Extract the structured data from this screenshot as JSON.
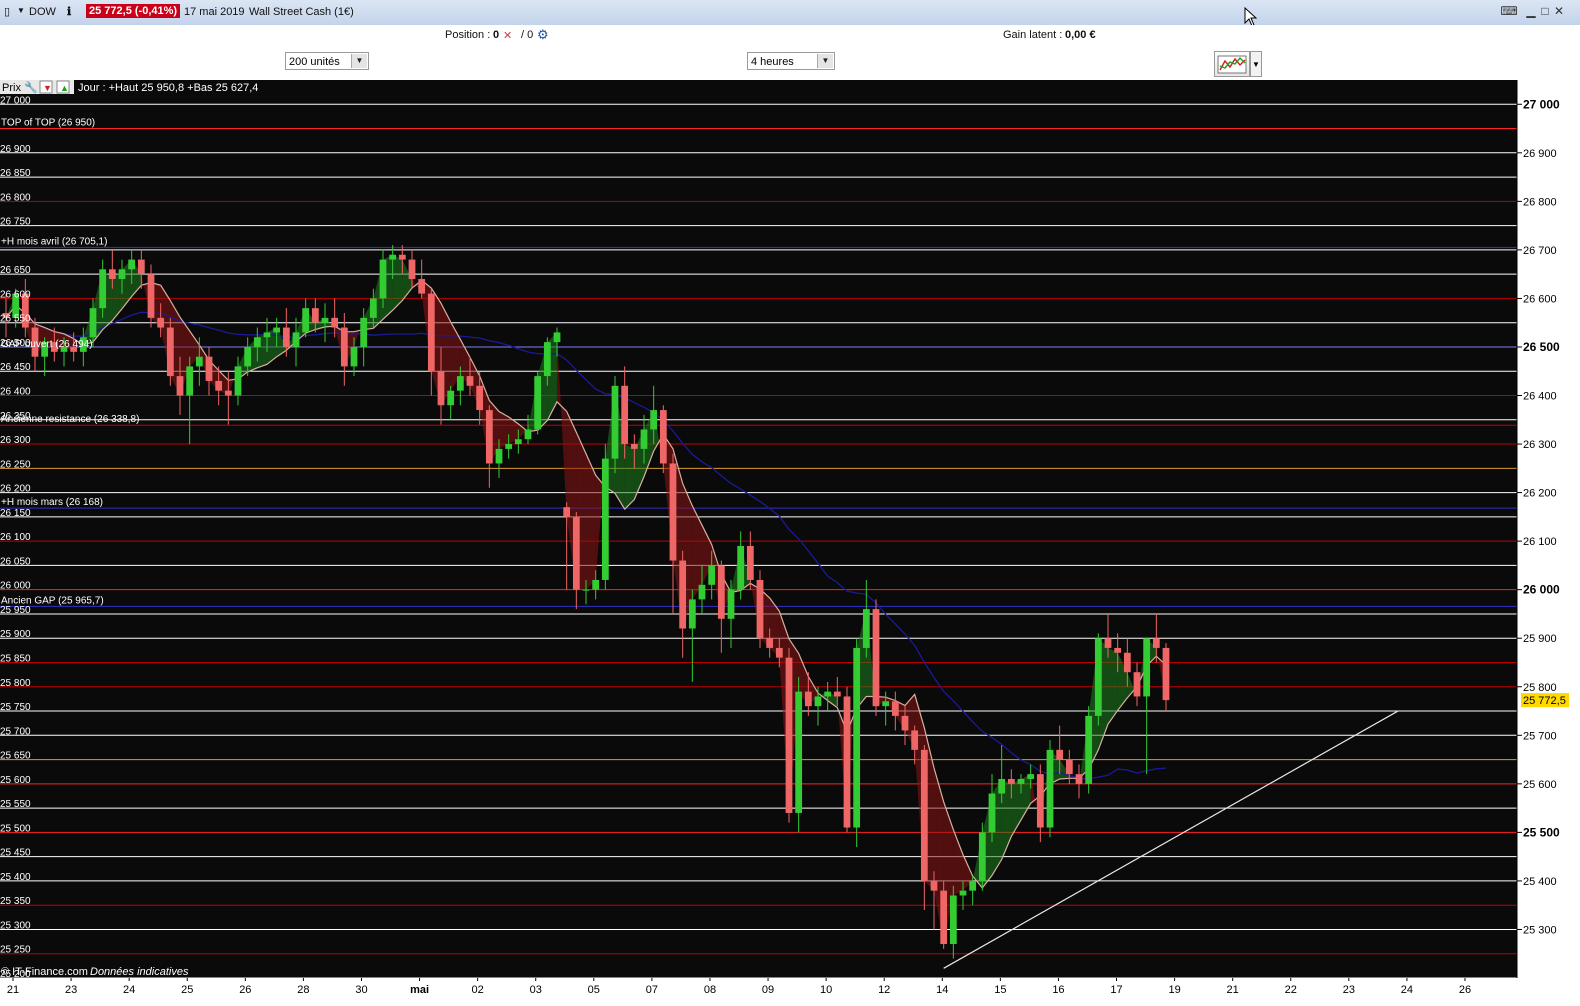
{
  "window": {
    "symbol": "DOW",
    "price_badge": "25 772,5 (-0,41%)",
    "date": "17 mai 2019",
    "instrument": "Wall Street Cash (1€)"
  },
  "infobar": {
    "position_label": "Position :",
    "position_value": "0",
    "position_sep": "/ 0",
    "gain_label": "Gain latent :",
    "gain_value": "0,00 €"
  },
  "toolbar": {
    "units_value": "200 unités",
    "timeframe_value": "4 heures"
  },
  "legend": {
    "prix": "Prix",
    "day_info": "Jour : +Haut 25 950,8 +Bas 25 627,4"
  },
  "footer": {
    "source": "© IT-Finance.com",
    "note": "Données indicatives"
  },
  "icons": [
    "window-icon",
    "dropdown-icon",
    "info-icon",
    "wrench-icon",
    "arrow-down-icon",
    "arrow-up-icon",
    "close-icon",
    "gear-icon",
    "keyboard-icon",
    "minimize-icon",
    "maximize-icon",
    "cursor-icon",
    "chart-type-icon",
    "chevron-down-icon"
  ],
  "colors": {
    "background": "#000000",
    "bull": "#33cc33",
    "bear": "#ee6666",
    "ma_short": "#d8b0a0",
    "ma_long": "#1a1a99",
    "price_tag": "#ffd800"
  },
  "chart_data": {
    "type": "candlestick",
    "ylim": [
      25200,
      27050
    ],
    "price_axis_ticks": [
      27000,
      26900,
      26800,
      26700,
      26600,
      26500,
      26400,
      26300,
      26200,
      26100,
      26000,
      25900,
      25800,
      25700,
      25600,
      25500,
      25400,
      25300
    ],
    "price_axis_bold": [
      27000,
      26500,
      26000,
      25500
    ],
    "left_level_labels": [
      "27 000",
      "26 900",
      "26 850",
      "26 800",
      "26 750",
      "26 650",
      "26 600",
      "26 550",
      "26 500",
      "26 450",
      "26 400",
      "26 350",
      "26 300",
      "26 250",
      "26 200",
      "26 150",
      "26 100",
      "26 050",
      "26 000",
      "25 950",
      "25 900",
      "25 850",
      "25 800",
      "25 750",
      "25 700",
      "25 650",
      "25 600",
      "25 550",
      "25 500",
      "25 450",
      "25 400",
      "25 350",
      "25 300",
      "25 250",
      "25 200"
    ],
    "level_label_values": [
      27000,
      26900,
      26850,
      26800,
      26750,
      26650,
      26600,
      26550,
      26500,
      26450,
      26400,
      26350,
      26300,
      26250,
      26200,
      26150,
      26100,
      26050,
      26000,
      25950,
      25900,
      25850,
      25800,
      25750,
      25700,
      25650,
      25600,
      25550,
      25500,
      25450,
      25400,
      25350,
      25300,
      25250,
      25200
    ],
    "grid_lines": [
      {
        "value": 27000,
        "color": "#ffffff"
      },
      {
        "value": 26950,
        "color": "#ff2020"
      },
      {
        "value": 26900,
        "color": "#ffffff"
      },
      {
        "value": 26850,
        "color": "#ffffff"
      },
      {
        "value": 26800,
        "color": "#c00000"
      },
      {
        "value": 26750,
        "color": "#ffffff"
      },
      {
        "value": 26705.1,
        "color": "#3030cc"
      },
      {
        "value": 26700,
        "color": "#ffffff"
      },
      {
        "value": 26650,
        "color": "#ffffff"
      },
      {
        "value": 26600,
        "color": "#c00000"
      },
      {
        "value": 26550,
        "color": "#ffffff"
      },
      {
        "value": 26500,
        "color": "#8080ff"
      },
      {
        "value": 26450,
        "color": "#ffffff"
      },
      {
        "value": 26400,
        "color": "#c00000"
      },
      {
        "value": 26350,
        "color": "#ffffff"
      },
      {
        "value": 26338.8,
        "color": "#c00000"
      },
      {
        "value": 26300,
        "color": "#c00000"
      },
      {
        "value": 26250,
        "color": "#d89a30"
      },
      {
        "value": 26200,
        "color": "#ffffff"
      },
      {
        "value": 26168,
        "color": "#3030cc"
      },
      {
        "value": 26150,
        "color": "#ffffff"
      },
      {
        "value": 26100,
        "color": "#c00000"
      },
      {
        "value": 26050,
        "color": "#ffffff"
      },
      {
        "value": 26000,
        "color": "#ff2020"
      },
      {
        "value": 25965.7,
        "color": "#3030cc"
      },
      {
        "value": 25950,
        "color": "#ffffff"
      },
      {
        "value": 25900,
        "color": "#ffffff"
      },
      {
        "value": 25850,
        "color": "#c00000"
      },
      {
        "value": 25800,
        "color": "#c00000"
      },
      {
        "value": 25750,
        "color": "#ffffff"
      },
      {
        "value": 25700,
        "color": "#ffffff"
      },
      {
        "value": 25650,
        "color": "#d89a30"
      },
      {
        "value": 25600,
        "color": "#ff2020"
      },
      {
        "value": 25550,
        "color": "#ffffff"
      },
      {
        "value": 25500,
        "color": "#ff2020"
      },
      {
        "value": 25450,
        "color": "#ffffff"
      },
      {
        "value": 25400,
        "color": "#ffffff"
      },
      {
        "value": 25350,
        "color": "#c00000"
      },
      {
        "value": 25300,
        "color": "#ffffff"
      },
      {
        "value": 25250,
        "color": "#c00000"
      },
      {
        "value": 25200,
        "color": "#ffffff"
      }
    ],
    "annotations": [
      {
        "text": "TOP of TOP (26 950)",
        "value": 26950
      },
      {
        "text": "+H mois avril (26 705,1)",
        "value": 26705.1
      },
      {
        "text": "GAP ouvert (26 494)",
        "value": 26494
      },
      {
        "text": "Ancienne resistance (26 338,8)",
        "value": 26338.8
      },
      {
        "text": "+H mois mars (26 168)",
        "value": 26168
      },
      {
        "text": "Ancien GAP (25 965,7)",
        "value": 25965.7
      }
    ],
    "last_price": 25772.5,
    "last_price_label": "25 772,5",
    "x_labels": [
      "21",
      "23",
      "24",
      "25",
      "26",
      "28",
      "30",
      "mai",
      "02",
      "03",
      "05",
      "07",
      "08",
      "09",
      "10",
      "12",
      "14",
      "15",
      "16",
      "17",
      "19",
      "21",
      "22",
      "23",
      "24",
      "26"
    ],
    "trendline": [
      {
        "bar": 0,
        "value": 25220
      },
      {
        "bar": 1,
        "value": 25750
      }
    ],
    "candles": [
      [
        26570,
        26610,
        26520,
        26560
      ],
      [
        26560,
        26620,
        26540,
        26610
      ],
      [
        26610,
        26640,
        26520,
        26540
      ],
      [
        26540,
        26560,
        26450,
        26480
      ],
      [
        26480,
        26520,
        26440,
        26510
      ],
      [
        26510,
        26540,
        26470,
        26490
      ],
      [
        26490,
        26520,
        26460,
        26500
      ],
      [
        26500,
        26530,
        26470,
        26490
      ],
      [
        26490,
        26540,
        26460,
        26520
      ],
      [
        26520,
        26600,
        26500,
        26580
      ],
      [
        26580,
        26680,
        26560,
        26660
      ],
      [
        26660,
        26700,
        26620,
        26640
      ],
      [
        26640,
        26680,
        26610,
        26660
      ],
      [
        26660,
        26700,
        26630,
        26680
      ],
      [
        26680,
        26700,
        26620,
        26650
      ],
      [
        26650,
        26670,
        26540,
        26560
      ],
      [
        26560,
        26590,
        26520,
        26540
      ],
      [
        26540,
        26560,
        26420,
        26440
      ],
      [
        26440,
        26480,
        26360,
        26400
      ],
      [
        26400,
        26480,
        26300,
        26460
      ],
      [
        26460,
        26520,
        26420,
        26480
      ],
      [
        26480,
        26500,
        26400,
        26430
      ],
      [
        26430,
        26460,
        26380,
        26410
      ],
      [
        26410,
        26450,
        26340,
        26400
      ],
      [
        26400,
        26480,
        26380,
        26460
      ],
      [
        26460,
        26520,
        26440,
        26500
      ],
      [
        26500,
        26540,
        26470,
        26520
      ],
      [
        26520,
        26560,
        26490,
        26530
      ],
      [
        26530,
        26560,
        26500,
        26540
      ],
      [
        26540,
        26580,
        26480,
        26500
      ],
      [
        26500,
        26560,
        26460,
        26530
      ],
      [
        26530,
        26600,
        26520,
        26580
      ],
      [
        26580,
        26600,
        26530,
        26550
      ],
      [
        26550,
        26590,
        26510,
        26560
      ],
      [
        26560,
        26600,
        26520,
        26540
      ],
      [
        26540,
        26570,
        26420,
        26460
      ],
      [
        26460,
        26520,
        26440,
        26500
      ],
      [
        26500,
        26580,
        26460,
        26560
      ],
      [
        26560,
        26620,
        26540,
        26600
      ],
      [
        26600,
        26700,
        26580,
        26680
      ],
      [
        26680,
        26710,
        26640,
        26690
      ],
      [
        26690,
        26710,
        26650,
        26680
      ],
      [
        26680,
        26700,
        26620,
        26640
      ],
      [
        26640,
        26680,
        26600,
        26610
      ],
      [
        26610,
        26620,
        26400,
        26450
      ],
      [
        26450,
        26500,
        26340,
        26380
      ],
      [
        26380,
        26420,
        26350,
        26410
      ],
      [
        26410,
        26460,
        26380,
        26440
      ],
      [
        26440,
        26480,
        26400,
        26420
      ],
      [
        26420,
        26450,
        26340,
        26370
      ],
      [
        26370,
        26380,
        26210,
        26260
      ],
      [
        26260,
        26310,
        26230,
        26290
      ],
      [
        26290,
        26320,
        26270,
        26300
      ],
      [
        26300,
        26330,
        26280,
        26310
      ],
      [
        26310,
        26360,
        26300,
        26330
      ],
      [
        26330,
        26450,
        26320,
        26440
      ],
      [
        26440,
        26520,
        26420,
        26510
      ],
      [
        26510,
        26540,
        26480,
        26530
      ],
      [
        26170,
        26180,
        26000,
        26150
      ],
      [
        26150,
        26160,
        25960,
        26000
      ],
      [
        26000,
        26020,
        25970,
        26000
      ],
      [
        26000,
        26040,
        25980,
        26020
      ],
      [
        26020,
        26300,
        26000,
        26270
      ],
      [
        26270,
        26440,
        26240,
        26420
      ],
      [
        26420,
        26460,
        26270,
        26300
      ],
      [
        26300,
        26320,
        26250,
        26290
      ],
      [
        26290,
        26360,
        26260,
        26330
      ],
      [
        26330,
        26420,
        26300,
        26370
      ],
      [
        26370,
        26380,
        26240,
        26260
      ],
      [
        26260,
        26280,
        25950,
        26060
      ],
      [
        26060,
        26080,
        25860,
        25920
      ],
      [
        25920,
        26000,
        25810,
        25980
      ],
      [
        25980,
        26050,
        25950,
        26010
      ],
      [
        26010,
        26080,
        25980,
        26050
      ],
      [
        26050,
        26060,
        25870,
        25940
      ],
      [
        25940,
        26020,
        25880,
        26000
      ],
      [
        26000,
        26120,
        25980,
        26090
      ],
      [
        26090,
        26120,
        26000,
        26020
      ],
      [
        26020,
        26040,
        25880,
        25900
      ],
      [
        25900,
        25920,
        25860,
        25880
      ],
      [
        25880,
        25900,
        25840,
        25860
      ],
      [
        25860,
        25880,
        25520,
        25540
      ],
      [
        25540,
        25820,
        25500,
        25790
      ],
      [
        25790,
        25830,
        25740,
        25760
      ],
      [
        25760,
        25800,
        25720,
        25780
      ],
      [
        25780,
        25810,
        25750,
        25790
      ],
      [
        25790,
        25820,
        25760,
        25780
      ],
      [
        25780,
        25800,
        25500,
        25510
      ],
      [
        25510,
        25900,
        25470,
        25880
      ],
      [
        25880,
        26020,
        25860,
        25960
      ],
      [
        25960,
        25980,
        25740,
        25760
      ],
      [
        25760,
        25790,
        25720,
        25770
      ],
      [
        25770,
        25790,
        25710,
        25740
      ],
      [
        25740,
        25760,
        25680,
        25710
      ],
      [
        25710,
        25720,
        25640,
        25670
      ],
      [
        25670,
        25680,
        25340,
        25400
      ],
      [
        25400,
        25420,
        25300,
        25380
      ],
      [
        25380,
        25400,
        25260,
        25270
      ],
      [
        25270,
        25390,
        25240,
        25370
      ],
      [
        25370,
        25400,
        25340,
        25380
      ],
      [
        25380,
        25410,
        25350,
        25400
      ],
      [
        25400,
        25520,
        25380,
        25500
      ],
      [
        25500,
        25620,
        25480,
        25580
      ],
      [
        25580,
        25680,
        25560,
        25610
      ],
      [
        25610,
        25630,
        25570,
        25600
      ],
      [
        25600,
        25620,
        25580,
        25610
      ],
      [
        25610,
        25640,
        25590,
        25620
      ],
      [
        25620,
        25640,
        25480,
        25510
      ],
      [
        25510,
        25690,
        25490,
        25670
      ],
      [
        25670,
        25720,
        25620,
        25650
      ],
      [
        25650,
        25670,
        25600,
        25620
      ],
      [
        25620,
        25640,
        25570,
        25600
      ],
      [
        25600,
        25760,
        25580,
        25740
      ],
      [
        25740,
        25910,
        25720,
        25900
      ],
      [
        25900,
        25950,
        25860,
        25880
      ],
      [
        25880,
        25910,
        25830,
        25870
      ],
      [
        25870,
        25900,
        25800,
        25830
      ],
      [
        25830,
        25850,
        25760,
        25780
      ],
      [
        25780,
        25900,
        25620,
        25900
      ],
      [
        25900,
        25950,
        25850,
        25880
      ],
      [
        25880,
        25890,
        25750,
        25772.5
      ]
    ]
  }
}
